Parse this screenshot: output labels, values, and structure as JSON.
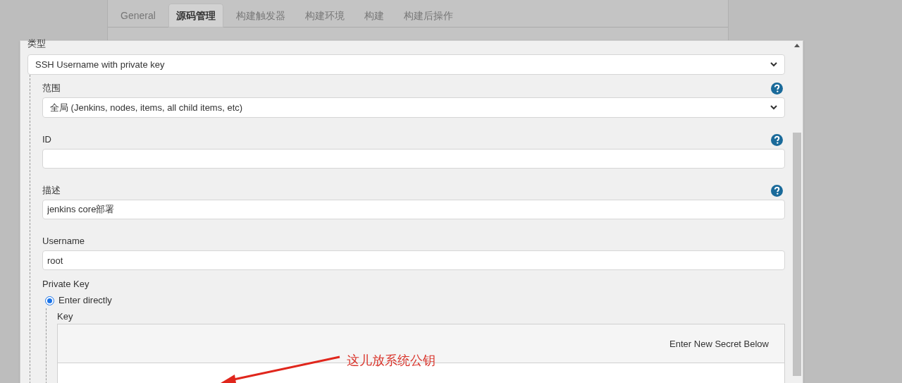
{
  "background_tabs": [
    {
      "label": "General",
      "selected": false
    },
    {
      "label": "源码管理",
      "selected": true
    },
    {
      "label": "构建触发器",
      "selected": false
    },
    {
      "label": "构建环境",
      "selected": false
    },
    {
      "label": "构建",
      "selected": false
    },
    {
      "label": "构建后操作",
      "selected": false
    }
  ],
  "dialog": {
    "type_field": {
      "label": "类型",
      "value": "SSH Username with private key"
    },
    "fields": [
      {
        "kind": "select",
        "label": "范围",
        "value": "全局 (Jenkins, nodes, items, all child items, etc)",
        "help": true
      },
      {
        "kind": "text",
        "label": "ID",
        "help": true
      },
      {
        "kind": "text",
        "label": "描述",
        "value": "jenkins core部署",
        "help": true
      },
      {
        "kind": "text",
        "label": "Username",
        "value": "root",
        "help": false
      }
    ],
    "private_key": {
      "label": "Private Key",
      "options": [
        {
          "label": "Enter directly",
          "selected": true
        }
      ],
      "key": {
        "label": "Key",
        "hint": "Enter New Secret Below"
      }
    }
  },
  "annotation": {
    "text": "这儿放系统公钥"
  }
}
